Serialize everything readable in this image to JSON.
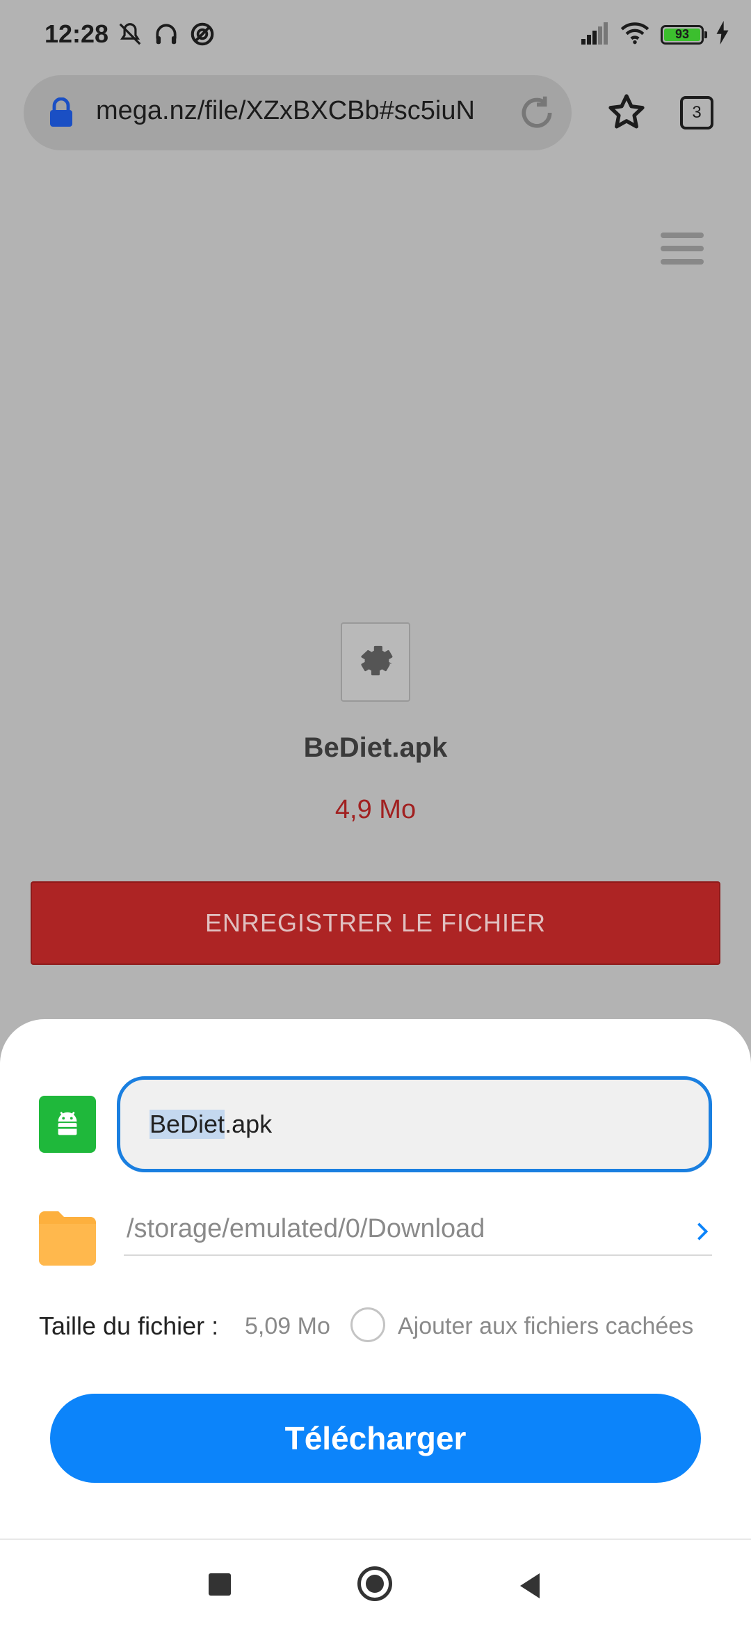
{
  "status_bar": {
    "time": "12:28",
    "battery": "93",
    "icons": [
      "mute-icon",
      "headphones-icon",
      "data-saver-icon",
      "signal-icon",
      "wifi-icon",
      "battery-icon",
      "charging-icon"
    ]
  },
  "browser": {
    "url": "mega.nz/file/XZxBXCBb#sc5iuN",
    "tab_count": "3"
  },
  "file": {
    "name": "BeDiet.apk",
    "size": "4,9 Mo",
    "save_button_label": "ENREGISTRER LE FICHIER"
  },
  "download_sheet": {
    "filename_selected": "BeDiet",
    "filename_rest": ".apk",
    "path": "/storage/emulated/0/Download",
    "size_label": "Taille du fichier :",
    "size_value": "5,09 Mo",
    "hidden_option_label": "Ajouter aux fichiers cachées",
    "download_button_label": "Télécharger"
  },
  "colors": {
    "accent": "#0c84fa",
    "save_button": "#ad2424",
    "apk_icon": "#1fb83b",
    "folder": "#fdb03e"
  }
}
